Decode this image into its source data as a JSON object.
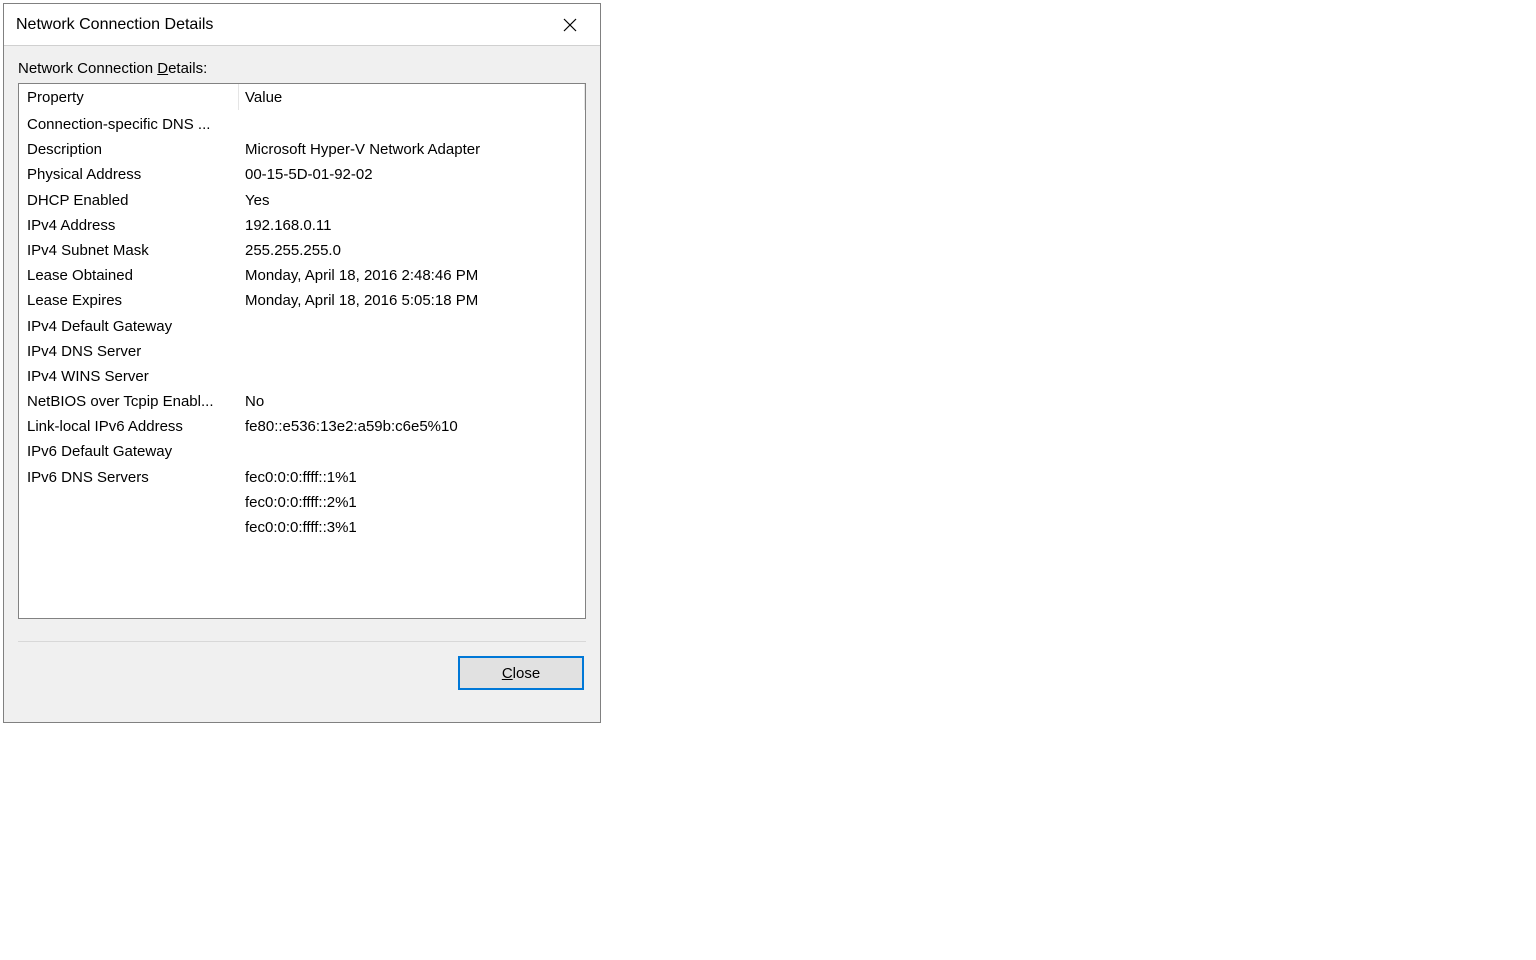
{
  "dialog": {
    "title": "Network Connection Details",
    "section_label_pre": "Network Connection ",
    "section_label_ul": "D",
    "section_label_post": "etails:",
    "columns": {
      "property": "Property",
      "value": "Value"
    },
    "rows": [
      {
        "property": "Connection-specific DNS ...",
        "value": ""
      },
      {
        "property": "Description",
        "value": "Microsoft Hyper-V Network Adapter"
      },
      {
        "property": "Physical Address",
        "value": "00-15-5D-01-92-02"
      },
      {
        "property": "DHCP Enabled",
        "value": "Yes"
      },
      {
        "property": "IPv4 Address",
        "value": "192.168.0.11"
      },
      {
        "property": "IPv4 Subnet Mask",
        "value": "255.255.255.0"
      },
      {
        "property": "Lease Obtained",
        "value": "Monday, April 18, 2016 2:48:46 PM"
      },
      {
        "property": "Lease Expires",
        "value": "Monday, April 18, 2016 5:05:18 PM"
      },
      {
        "property": "IPv4 Default Gateway",
        "value": ""
      },
      {
        "property": "IPv4 DNS Server",
        "value": ""
      },
      {
        "property": "IPv4 WINS Server",
        "value": ""
      },
      {
        "property": "NetBIOS over Tcpip Enabl...",
        "value": "No"
      },
      {
        "property": "Link-local IPv6 Address",
        "value": "fe80::e536:13e2:a59b:c6e5%10"
      },
      {
        "property": "IPv6 Default Gateway",
        "value": ""
      },
      {
        "property": "IPv6 DNS Servers",
        "value": "fec0:0:0:ffff::1%1"
      },
      {
        "property": "",
        "value": "fec0:0:0:ffff::2%1"
      },
      {
        "property": "",
        "value": "fec0:0:0:ffff::3%1"
      }
    ],
    "close_button_ul": "C",
    "close_button_post": "lose"
  }
}
